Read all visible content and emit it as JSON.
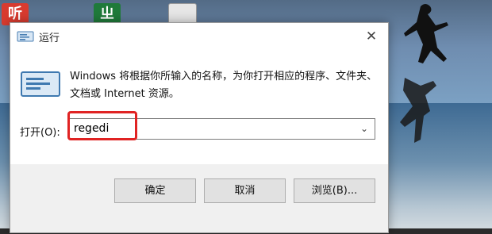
{
  "desktop": {
    "icon_a_text": "听",
    "icon_b_text": "ㄓ"
  },
  "dialog": {
    "title": "运行",
    "close_glyph": "✕",
    "description": "Windows 将根据你所输入的名称，为你打开相应的程序、文件夹、文档或 Internet 资源。",
    "open_label": "打开(O):",
    "open_value": "regedi",
    "dropdown_glyph": "⌄",
    "buttons": {
      "ok": "确定",
      "cancel": "取消",
      "browse": "浏览(B)..."
    }
  },
  "colors": {
    "highlight_border": "#e02323",
    "button_bg": "#e1e1e1",
    "footer_bg": "#f0f0f0"
  }
}
